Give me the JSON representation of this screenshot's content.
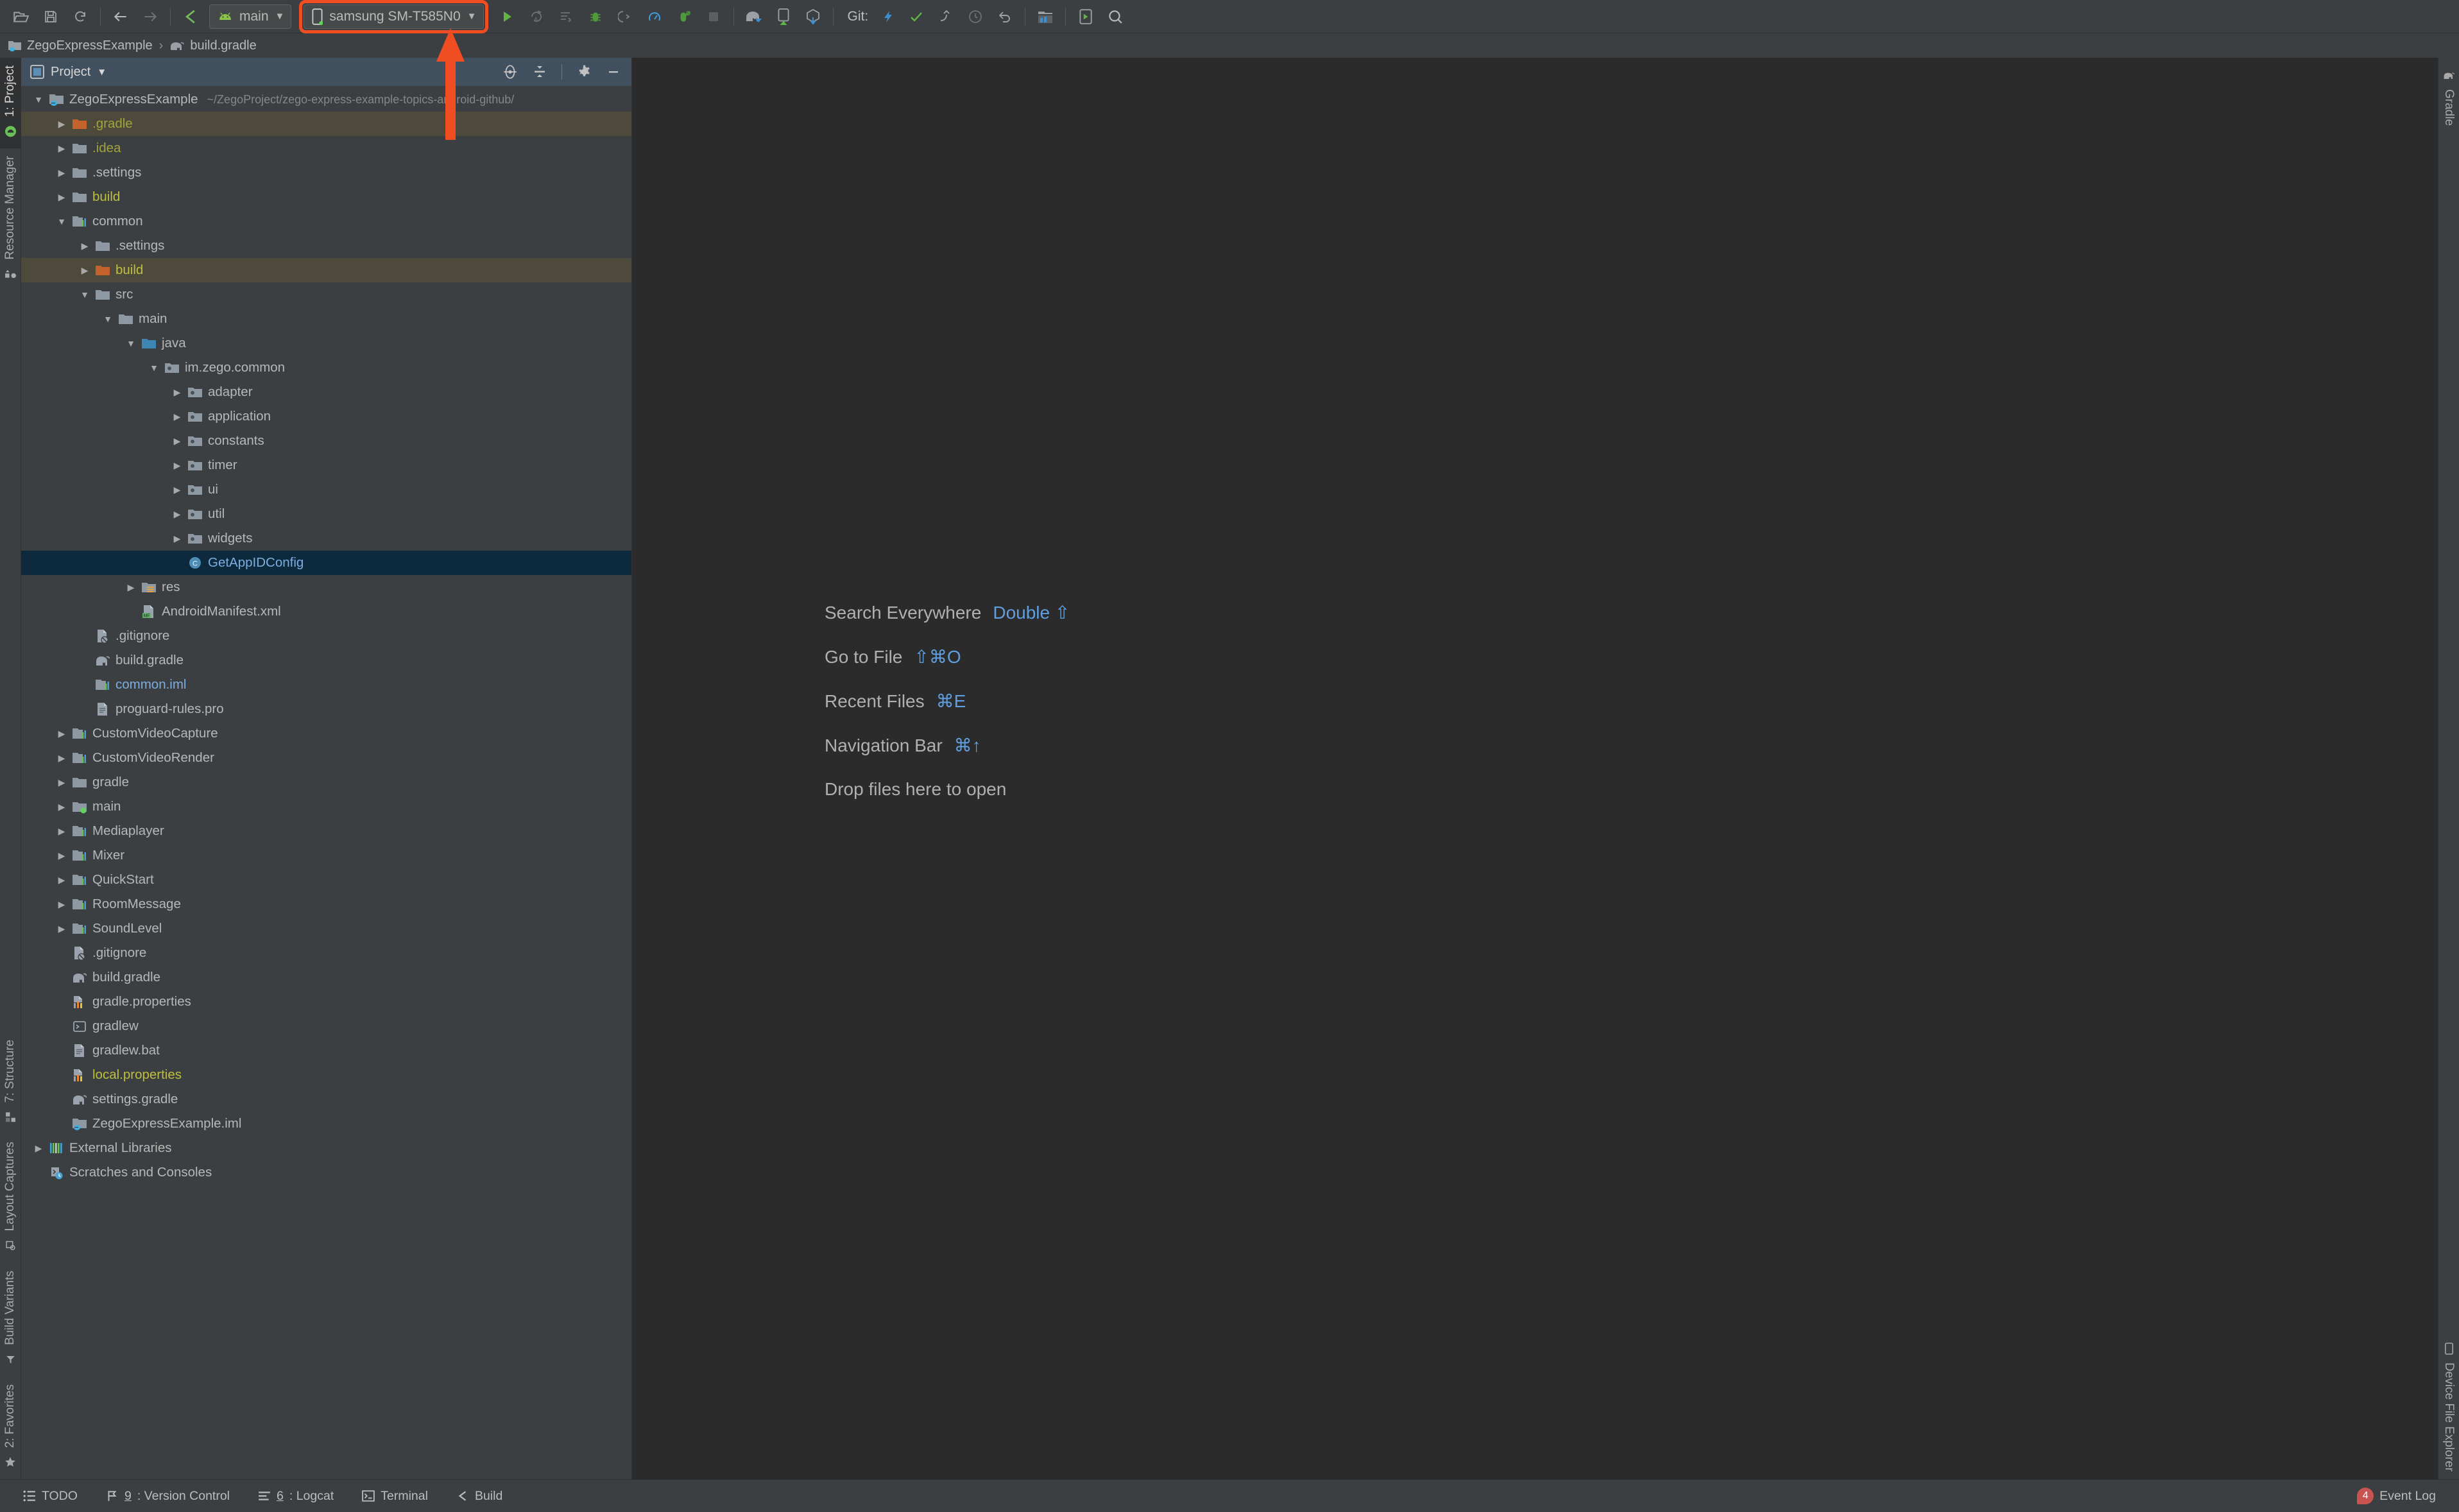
{
  "toolbar": {
    "icons": [
      {
        "name": "open-folder-icon",
        "glyph": "folder-open"
      },
      {
        "name": "save-all-icon",
        "glyph": "save"
      },
      {
        "name": "sync-icon",
        "glyph": "sync"
      },
      {
        "name": "back-icon",
        "glyph": "arrow-left"
      },
      {
        "name": "forward-icon",
        "glyph": "arrow-right"
      },
      {
        "name": "build-hammer-icon",
        "glyph": "hammer"
      }
    ],
    "module_selector": {
      "label": "main",
      "icon": "android-head-icon",
      "caret": "▼"
    },
    "device_selector": {
      "label": "samsung SM-T585N0",
      "icon": "phone-icon",
      "caret": "▼",
      "highlight_color": "#f04d23"
    },
    "run_icons": [
      {
        "name": "run-button",
        "glyph": "play"
      },
      {
        "name": "apply-changes-restart-icon",
        "glyph": "apply-restart"
      },
      {
        "name": "apply-code-changes-icon",
        "glyph": "apply-code"
      },
      {
        "name": "debug-icon",
        "glyph": "bug"
      },
      {
        "name": "attach-debugger-icon",
        "glyph": "attach"
      },
      {
        "name": "profile-icon",
        "glyph": "profiler"
      },
      {
        "name": "run-with-coverage-icon",
        "glyph": "coverage"
      },
      {
        "name": "stop-icon",
        "glyph": "stop"
      }
    ],
    "tool_icons": [
      {
        "name": "sync-gradle-icon",
        "glyph": "elephant-sync"
      },
      {
        "name": "avd-manager-icon",
        "glyph": "avd"
      },
      {
        "name": "sdk-manager-icon",
        "glyph": "sdk"
      }
    ],
    "git_label": "Git:",
    "vcs_icons": [
      {
        "name": "update-project-icon",
        "glyph": "arrow-down-blue"
      },
      {
        "name": "commit-icon",
        "glyph": "check-green"
      },
      {
        "name": "push-icon",
        "glyph": "push"
      },
      {
        "name": "history-icon",
        "glyph": "clock"
      },
      {
        "name": "rollback-icon",
        "glyph": "undo"
      }
    ],
    "right_icons": [
      {
        "name": "project-structure-icon",
        "glyph": "structure"
      },
      {
        "name": "device-manager-icon",
        "glyph": "device"
      },
      {
        "name": "search-everywhere-icon",
        "glyph": "magnifier"
      }
    ]
  },
  "breadcrumb": {
    "project": "ZegoExpressExample",
    "separator": "›",
    "file": "build.gradle"
  },
  "project_panel": {
    "title": "Project",
    "caret": "▼",
    "icons": [
      {
        "name": "locate-file-icon"
      },
      {
        "name": "collapse-all-icon"
      },
      {
        "name": "settings-gear-icon"
      },
      {
        "name": "hide-panel-icon"
      }
    ]
  },
  "tree": [
    {
      "depth": 0,
      "arrow": "▼",
      "icon": "module-java-folder",
      "label": "ZegoExpressExample",
      "color": "white",
      "path": "~/ZegoProject/zego-express-example-topics-android-github/"
    },
    {
      "depth": 1,
      "arrow": "▶",
      "icon": "folder-orange",
      "label": ".gradle",
      "color": "olive",
      "state": "highlight"
    },
    {
      "depth": 1,
      "arrow": "▶",
      "icon": "folder",
      "label": ".idea",
      "color": "olive"
    },
    {
      "depth": 1,
      "arrow": "▶",
      "icon": "folder",
      "label": ".settings",
      "color": "white"
    },
    {
      "depth": 1,
      "arrow": "▶",
      "icon": "folder",
      "label": "build",
      "color": "yellow"
    },
    {
      "depth": 1,
      "arrow": "▼",
      "icon": "module",
      "label": "common",
      "color": "white"
    },
    {
      "depth": 2,
      "arrow": "▶",
      "icon": "folder",
      "label": ".settings",
      "color": "white"
    },
    {
      "depth": 2,
      "arrow": "▶",
      "icon": "folder-orange",
      "label": "build",
      "color": "yellow",
      "state": "highlight"
    },
    {
      "depth": 2,
      "arrow": "▼",
      "icon": "folder",
      "label": "src",
      "color": "white"
    },
    {
      "depth": 3,
      "arrow": "▼",
      "icon": "folder",
      "label": "main",
      "color": "white"
    },
    {
      "depth": 4,
      "arrow": "▼",
      "icon": "folder-blue",
      "label": "java",
      "color": "white"
    },
    {
      "depth": 5,
      "arrow": "▼",
      "icon": "package",
      "label": "im.zego.common",
      "color": "white"
    },
    {
      "depth": 6,
      "arrow": "▶",
      "icon": "package",
      "label": "adapter",
      "color": "white"
    },
    {
      "depth": 6,
      "arrow": "▶",
      "icon": "package",
      "label": "application",
      "color": "white"
    },
    {
      "depth": 6,
      "arrow": "▶",
      "icon": "package",
      "label": "constants",
      "color": "white"
    },
    {
      "depth": 6,
      "arrow": "▶",
      "icon": "package",
      "label": "timer",
      "color": "white"
    },
    {
      "depth": 6,
      "arrow": "▶",
      "icon": "package",
      "label": "ui",
      "color": "white"
    },
    {
      "depth": 6,
      "arrow": "▶",
      "icon": "package",
      "label": "util",
      "color": "white"
    },
    {
      "depth": 6,
      "arrow": "▶",
      "icon": "package",
      "label": "widgets",
      "color": "white"
    },
    {
      "depth": 6,
      "arrow": "",
      "icon": "java-class",
      "label": "GetAppIDConfig",
      "color": "blue",
      "state": "selected"
    },
    {
      "depth": 4,
      "arrow": "▶",
      "icon": "res-folder",
      "label": "res",
      "color": "white"
    },
    {
      "depth": 4,
      "arrow": "",
      "icon": "manifest",
      "label": "AndroidManifest.xml",
      "color": "white"
    },
    {
      "depth": 2,
      "arrow": "",
      "icon": "gitignore",
      "label": ".gitignore",
      "color": "white"
    },
    {
      "depth": 2,
      "arrow": "",
      "icon": "gradle-elephant",
      "label": "build.gradle",
      "color": "white"
    },
    {
      "depth": 2,
      "arrow": "",
      "icon": "iml",
      "label": "common.iml",
      "color": "blue"
    },
    {
      "depth": 2,
      "arrow": "",
      "icon": "text-file",
      "label": "proguard-rules.pro",
      "color": "white"
    },
    {
      "depth": 1,
      "arrow": "▶",
      "icon": "module",
      "label": "CustomVideoCapture",
      "color": "white"
    },
    {
      "depth": 1,
      "arrow": "▶",
      "icon": "module",
      "label": "CustomVideoRender",
      "color": "white"
    },
    {
      "depth": 1,
      "arrow": "▶",
      "icon": "folder",
      "label": "gradle",
      "color": "white"
    },
    {
      "depth": 1,
      "arrow": "▶",
      "icon": "folder-green-dot",
      "label": "main",
      "color": "white"
    },
    {
      "depth": 1,
      "arrow": "▶",
      "icon": "module",
      "label": "Mediaplayer",
      "color": "white"
    },
    {
      "depth": 1,
      "arrow": "▶",
      "icon": "module",
      "label": "Mixer",
      "color": "white"
    },
    {
      "depth": 1,
      "arrow": "▶",
      "icon": "module",
      "label": "QuickStart",
      "color": "white"
    },
    {
      "depth": 1,
      "arrow": "▶",
      "icon": "module",
      "label": "RoomMessage",
      "color": "white"
    },
    {
      "depth": 1,
      "arrow": "▶",
      "icon": "module",
      "label": "SoundLevel",
      "color": "white"
    },
    {
      "depth": 1,
      "arrow": "",
      "icon": "gitignore",
      "label": ".gitignore",
      "color": "white"
    },
    {
      "depth": 1,
      "arrow": "",
      "icon": "gradle-elephant",
      "label": "build.gradle",
      "color": "white"
    },
    {
      "depth": 1,
      "arrow": "",
      "icon": "properties",
      "label": "gradle.properties",
      "color": "white"
    },
    {
      "depth": 1,
      "arrow": "",
      "icon": "shell",
      "label": "gradlew",
      "color": "white"
    },
    {
      "depth": 1,
      "arrow": "",
      "icon": "text-file",
      "label": "gradlew.bat",
      "color": "white"
    },
    {
      "depth": 1,
      "arrow": "",
      "icon": "properties",
      "label": "local.properties",
      "color": "yellow"
    },
    {
      "depth": 1,
      "arrow": "",
      "icon": "gradle-elephant",
      "label": "settings.gradle",
      "color": "white"
    },
    {
      "depth": 1,
      "arrow": "",
      "icon": "module-java-folder",
      "label": "ZegoExpressExample.iml",
      "color": "white"
    },
    {
      "depth": 0,
      "arrow": "▶",
      "icon": "libraries",
      "label": "External Libraries",
      "color": "white"
    },
    {
      "depth": 0,
      "arrow": "",
      "icon": "scratches",
      "label": "Scratches and Consoles",
      "color": "white"
    }
  ],
  "editor_hints": [
    {
      "label": "Search Everywhere",
      "key": "Double ⇧"
    },
    {
      "label": "Go to File",
      "key": "⇧⌘O"
    },
    {
      "label": "Recent Files",
      "key": "⌘E"
    },
    {
      "label": "Navigation Bar",
      "key": "⌘↑"
    },
    {
      "label": "Drop files here to open",
      "key": ""
    }
  ],
  "left_rail": {
    "top": [
      {
        "label": "1: Project",
        "icon": "android-studio-icon",
        "active": true,
        "underline": "1"
      },
      {
        "label": "Resource Manager",
        "icon": "resource-manager-icon",
        "active": false
      }
    ],
    "bottom": [
      {
        "label": "7: Structure",
        "icon": "structure-icon",
        "underline": "7"
      },
      {
        "label": "Layout Captures",
        "icon": "layout-captures-icon"
      },
      {
        "label": "Build Variants",
        "icon": "build-variants-icon"
      },
      {
        "label": "2: Favorites",
        "icon": "star-icon",
        "underline": "2"
      }
    ]
  },
  "right_rail": {
    "top": [
      {
        "label": "Gradle",
        "icon": "gradle-elephant-icon"
      }
    ],
    "bottom": [
      {
        "label": "Device File Explorer",
        "icon": "device-icon"
      }
    ]
  },
  "status_bar": {
    "items": [
      {
        "label": "TODO",
        "icon": "todo-icon",
        "mnemonic": ""
      },
      {
        "label": ": Version Control",
        "icon": "version-control-icon",
        "mnemonic": "9"
      },
      {
        "label": ": Logcat",
        "icon": "logcat-icon",
        "mnemonic": "6"
      },
      {
        "label": "Terminal",
        "icon": "terminal-icon",
        "mnemonic": ""
      },
      {
        "label": "Build",
        "icon": "build-hammer-icon",
        "mnemonic": ""
      }
    ],
    "event_log": {
      "label": "Event Log",
      "count": "4",
      "badge_color": "#c75450"
    }
  },
  "annotation": {
    "arrow_color": "#f04d23",
    "target": "device_selector"
  },
  "colors": {
    "toolbar_bg": "#3c3f41",
    "editor_bg": "#2b2b2b",
    "panel_header_bg": "#41505f",
    "selection_bg": "#0d293e",
    "highlight_bg": "#4e4a3b",
    "accent_blue": "#5f9fe0",
    "annotation": "#f04d23"
  }
}
